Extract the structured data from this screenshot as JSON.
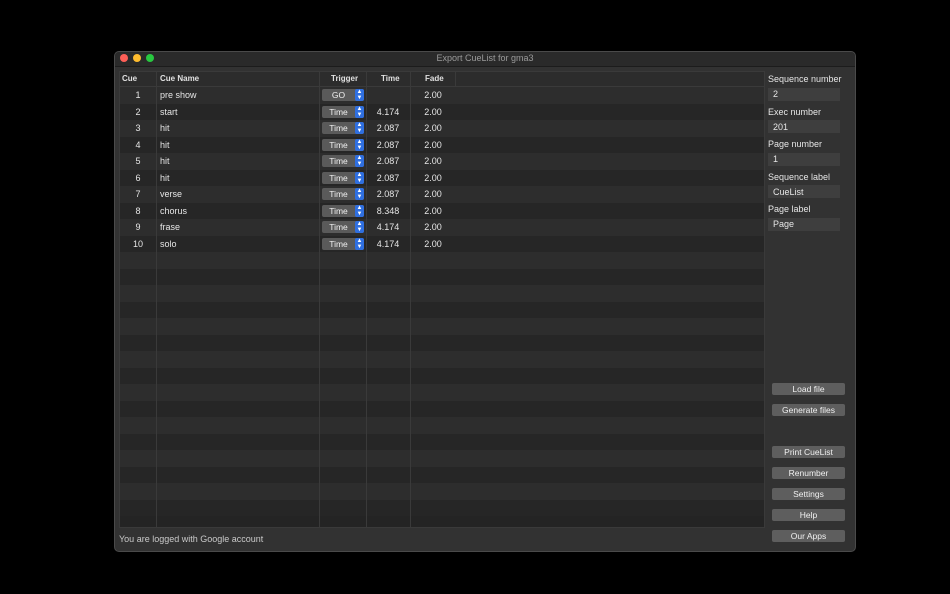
{
  "window": {
    "title": "Export CueList for gma3"
  },
  "table": {
    "headers": {
      "cue": "Cue",
      "name": "Cue Name",
      "trigger": "Trigger",
      "time": "Time",
      "fade": "Fade"
    },
    "rows": [
      {
        "cue": "1",
        "name": "pre show",
        "trigger": "GO",
        "time": "",
        "fade": "2.00"
      },
      {
        "cue": "2",
        "name": "start",
        "trigger": "Time",
        "time": "4.174",
        "fade": "2.00"
      },
      {
        "cue": "3",
        "name": "hit",
        "trigger": "Time",
        "time": "2.087",
        "fade": "2.00"
      },
      {
        "cue": "4",
        "name": "hit",
        "trigger": "Time",
        "time": "2.087",
        "fade": "2.00"
      },
      {
        "cue": "5",
        "name": "hit",
        "trigger": "Time",
        "time": "2.087",
        "fade": "2.00"
      },
      {
        "cue": "6",
        "name": "hit",
        "trigger": "Time",
        "time": "2.087",
        "fade": "2.00"
      },
      {
        "cue": "7",
        "name": "verse",
        "trigger": "Time",
        "time": "2.087",
        "fade": "2.00"
      },
      {
        "cue": "8",
        "name": "chorus",
        "trigger": "Time",
        "time": "8.348",
        "fade": "2.00"
      },
      {
        "cue": "9",
        "name": "frase",
        "trigger": "Time",
        "time": "4.174",
        "fade": "2.00"
      },
      {
        "cue": "10",
        "name": "solo",
        "trigger": "Time",
        "time": "4.174",
        "fade": "2.00"
      }
    ]
  },
  "sidebar": {
    "sequence_number_label": "Sequence number",
    "sequence_number": "2",
    "exec_number_label": "Exec number",
    "exec_number": "201",
    "page_number_label": "Page number",
    "page_number": "1",
    "sequence_label_label": "Sequence label",
    "sequence_label": "CueList",
    "page_label_label": "Page label",
    "page_label": "Page"
  },
  "buttons": {
    "load_file": "Load file",
    "generate_files": "Generate files",
    "print_cuelist": "Print CueList",
    "renumber": "Renumber",
    "settings": "Settings",
    "help": "Help",
    "our_apps": "Our Apps"
  },
  "status": "You are logged with Google account",
  "icons": {
    "trigger_stepper": "up-down-chevron-icon"
  },
  "colors": {
    "accent": "#2f6fe0",
    "background": "#323232"
  }
}
